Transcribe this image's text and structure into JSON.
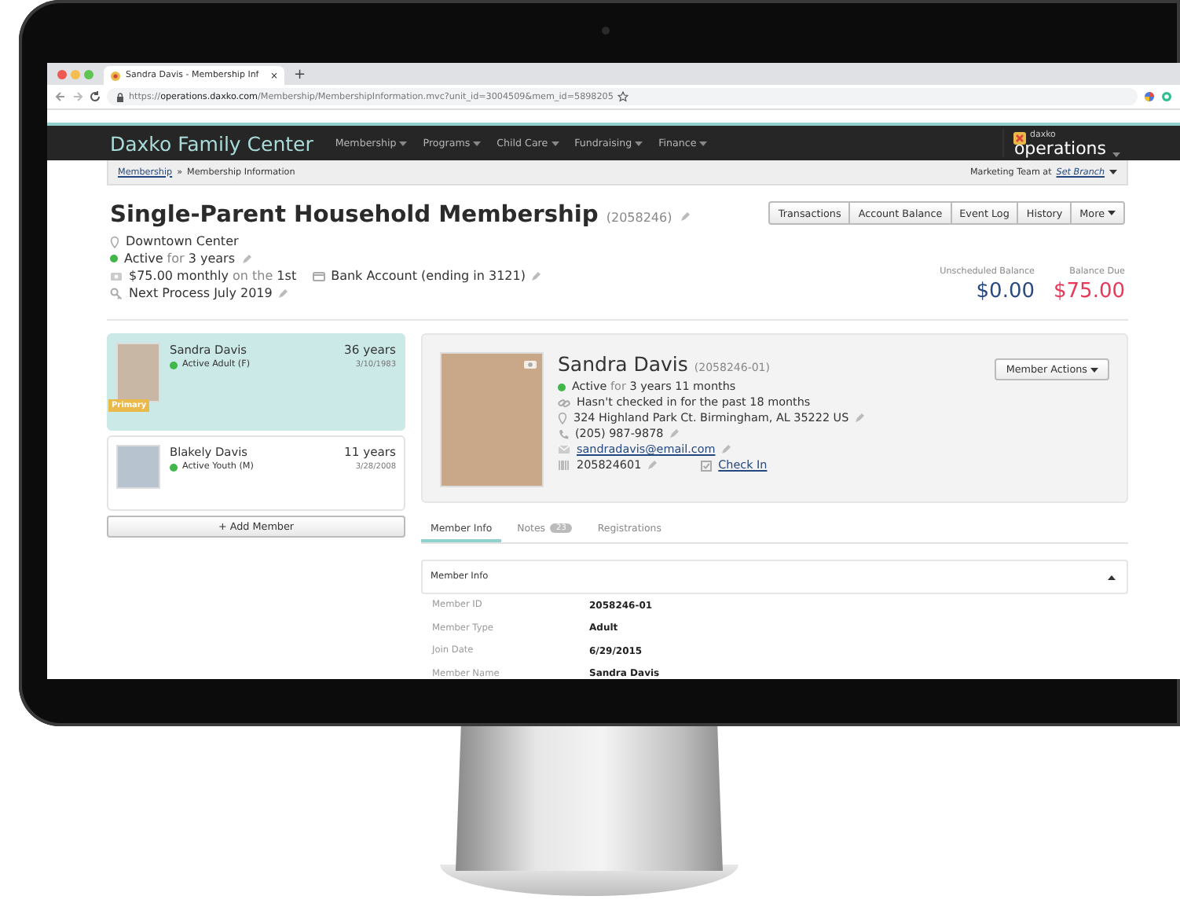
{
  "browser": {
    "tab_title": "Sandra Davis - Membership Inf",
    "tab_close": "×",
    "new_tab": "+",
    "url_scheme": "https://",
    "url_host": "operations.daxko.com",
    "url_path": "/Membership/MembershipInformation.mvc?unit_id=3004509&mem_id=5898205"
  },
  "nav": {
    "brand": "Daxko Family Center",
    "menus": [
      "Membership",
      "Programs",
      "Child Care",
      "Fundraising",
      "Finance"
    ],
    "logo_small": "daxko",
    "logo_large": "operations"
  },
  "breadcrumb": {
    "link": "Membership",
    "separator": "»",
    "current": "Membership Information",
    "branch_label": "Marketing Team at",
    "branch_link": "Set Branch"
  },
  "membership": {
    "title": "Single-Parent Household Membership",
    "id": "(2058246)",
    "actions": [
      {
        "label": "Transactions",
        "dropdown": false
      },
      {
        "label": "Account Balance",
        "dropdown": false
      },
      {
        "label": "Event Log",
        "dropdown": false
      },
      {
        "label": "History",
        "dropdown": false
      },
      {
        "label": "More",
        "dropdown": true
      }
    ],
    "location": "Downtown Center",
    "status": {
      "label": "Active",
      "joiner": "for",
      "value": "3 years"
    },
    "payment": {
      "amount": "$75.00 monthly",
      "joiner": "on the",
      "day": "1st",
      "method": "Bank Account (ending in 3121)"
    },
    "next_process": "Next Process July 2019",
    "balances": [
      {
        "label": "Unscheduled Balance",
        "value": "$0.00",
        "color": "#29497f"
      },
      {
        "label": "Balance Due",
        "value": "$75.00",
        "color": "#e8385a"
      }
    ]
  },
  "members": [
    {
      "name": "Sandra Davis",
      "status": "Active Adult (F)",
      "age": "36 years",
      "birth_date": "3/10/1983",
      "badge": "Primary",
      "selected": true
    },
    {
      "name": "Blakely Davis",
      "status": "Active Youth (M)",
      "age": "11 years",
      "birth_date": "3/28/2008",
      "selected": false
    }
  ],
  "add_member": "+ Add Member",
  "profile": {
    "name": "Sandra Davis",
    "id": "(2058246-01)",
    "actions": "Member Actions",
    "status": {
      "label": "Active",
      "joiner": "for",
      "value": "3 years 11 months"
    },
    "check_in_note": "Hasn't checked in for the past 18 months",
    "address": "324 Highland Park Ct. Birmingham, AL 35222 US",
    "phone": "(205) 987-9878",
    "email": "sandradavis@email.com",
    "barcode": "205824601",
    "check_in": "Check In"
  },
  "tabs": [
    {
      "label": "Member Info",
      "selected": true
    },
    {
      "label": "Notes",
      "count": "23",
      "selected": false
    },
    {
      "label": "Registrations",
      "selected": false
    }
  ],
  "section": {
    "title": "Member Info",
    "expanded": true,
    "fields": [
      {
        "label": "Member ID",
        "value": "2058246-01"
      },
      {
        "label": "Member Type",
        "value": "Adult"
      },
      {
        "label": "Join Date",
        "value": "6/29/2015"
      },
      {
        "label": "Member Name",
        "value": "Sandra Davis"
      }
    ]
  }
}
